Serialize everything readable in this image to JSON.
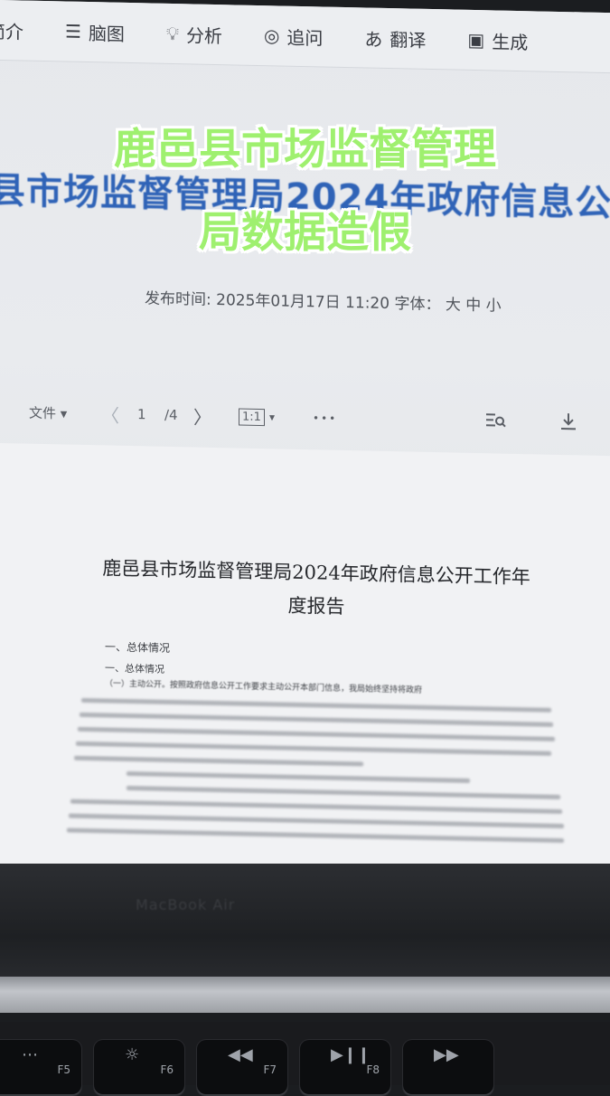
{
  "toolbar": {
    "items": [
      {
        "label": "简介",
        "icon": "intro-icon"
      },
      {
        "label": "脑图",
        "icon": "mindmap-icon"
      },
      {
        "label": "分析",
        "icon": "lightbulb-icon"
      },
      {
        "label": "追问",
        "icon": "chat-icon"
      },
      {
        "label": "翻译",
        "icon": "translate-icon"
      },
      {
        "label": "生成",
        "icon": "generate-icon"
      }
    ]
  },
  "article": {
    "headline": "县市场监督管理局2024年政府信息公",
    "meta": "发布时间: 2025年01月17日 11:20 字体： 大 中 小"
  },
  "pdf_viewer": {
    "file_menu": "文件 ▾",
    "prev": "〈",
    "page_current": "1",
    "page_total": "/4",
    "next": "〉",
    "zoom": "1:1",
    "zoom_caret": "▾",
    "more": "•••",
    "search_icon": "search-doc-icon",
    "download_icon": "download-icon"
  },
  "document": {
    "title_line1": "鹿邑县市场监督管理局2024年政府信息公开工作年",
    "title_line2": "度报告",
    "section1": "一、总体情况",
    "subsection1": "一、总体情况",
    "body_intro": "（一）主动公开。按照政府信息公开工作要求主动公开本部门信息，我局始终坚持将政府"
  },
  "caption": {
    "line1": "鹿邑县市场监督管理",
    "line2": "局数据造假"
  },
  "laptop": {
    "brand": "MacBook Air",
    "keys": [
      "F5",
      "F6",
      "F7",
      "F8"
    ]
  },
  "colors": {
    "caption_fill": "#9ff06f",
    "headline_blue": "#2f63b7"
  }
}
